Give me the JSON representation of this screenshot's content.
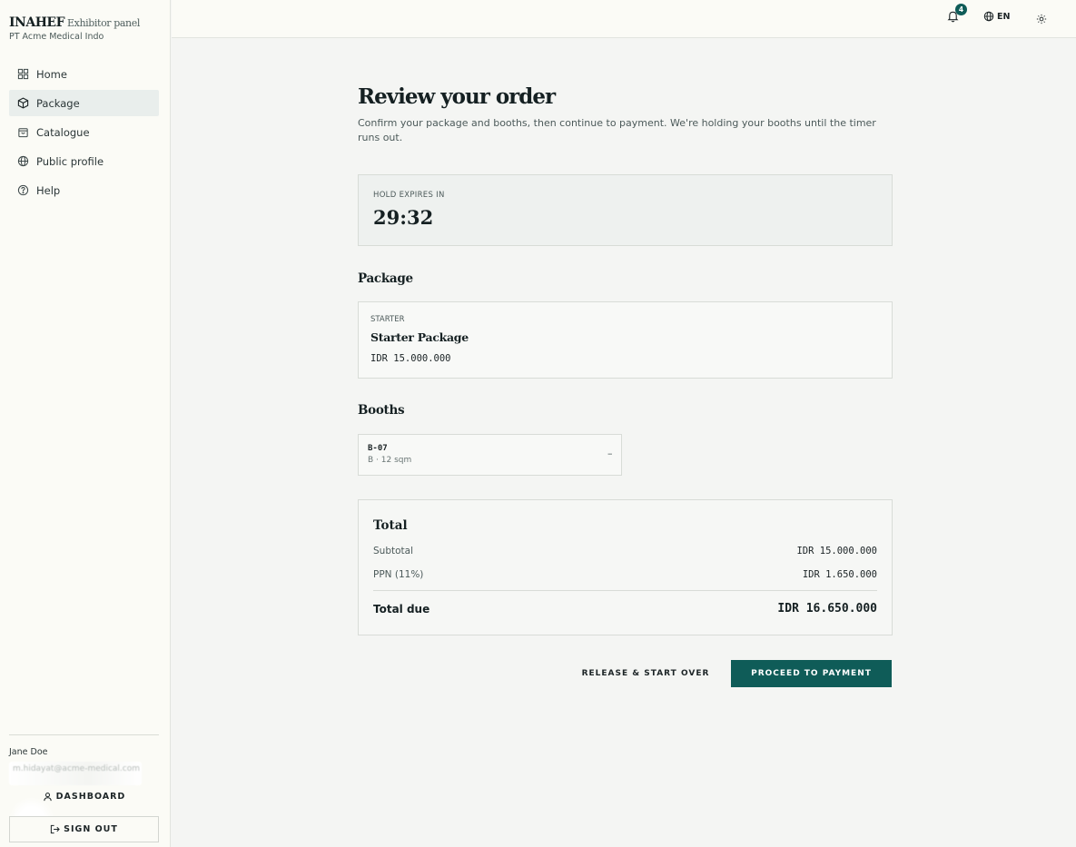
{
  "brand": {
    "name": "INAHEF",
    "subtitle": "Exhibitor panel",
    "company": "PT Acme Medical Indo"
  },
  "sidebar": {
    "items": [
      {
        "label": "Home",
        "icon": "grid-icon",
        "active": false
      },
      {
        "label": "Package",
        "icon": "box-icon",
        "active": true
      },
      {
        "label": "Catalogue",
        "icon": "bag-icon",
        "active": false
      },
      {
        "label": "Public profile",
        "icon": "globe-icon",
        "active": false
      },
      {
        "label": "Help",
        "icon": "help-circle-icon",
        "active": false
      }
    ],
    "user": {
      "name": "Jane Doe",
      "email": "m.hidayat@acme-medical.com"
    },
    "dashboard_label": "DASHBOARD",
    "signout_label": "SIGN OUT"
  },
  "topbar": {
    "notification_count": "4",
    "language": "EN"
  },
  "main": {
    "title": "Review your order",
    "subtitle": "Confirm your package and booths, then continue to payment. We're holding your booths until the timer runs out.",
    "hold": {
      "label": "HOLD EXPIRES IN",
      "timer": "29:32"
    },
    "package_heading": "Package",
    "package": {
      "tier": "STARTER",
      "name": "Starter Package",
      "price": "IDR 15.000.000"
    },
    "booths_heading": "Booths",
    "booths": [
      {
        "code": "B-07",
        "meta": "B · 12 sqm",
        "action": "–"
      }
    ],
    "total": {
      "heading": "Total",
      "subtotal_label": "Subtotal",
      "subtotal_value": "IDR 15.000.000",
      "tax_label": "PPN (11%)",
      "tax_value": "IDR 1.650.000",
      "due_label": "Total due",
      "due_value": "IDR 16.650.000"
    },
    "release_label": "RELEASE & START OVER",
    "proceed_label": "PROCEED TO PAYMENT"
  },
  "colors": {
    "accent": "#0f5c58",
    "background": "#f4f5f3",
    "sidebar": "#fbfbf6"
  }
}
